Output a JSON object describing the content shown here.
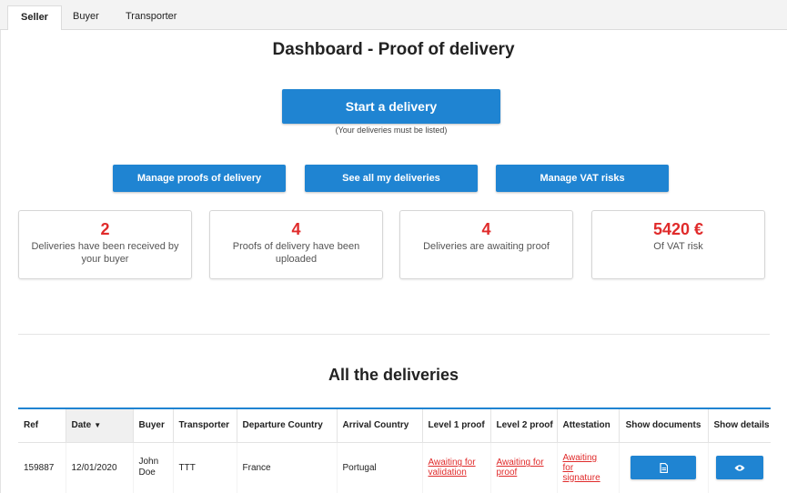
{
  "tabs": [
    "Seller",
    "Buyer",
    "Transporter"
  ],
  "title": "Dashboard - Proof of delivery",
  "start_button": "Start a delivery",
  "start_note": "(Your deliveries must be listed)",
  "actions": [
    "Manage proofs of delivery",
    "See all my deliveries",
    "Manage VAT risks"
  ],
  "stats": [
    {
      "value": "2",
      "label": "Deliveries have been received by your buyer"
    },
    {
      "value": "4",
      "label": "Proofs of delivery have been uploaded"
    },
    {
      "value": "4",
      "label": "Deliveries are awaiting proof"
    },
    {
      "value": "5420 €",
      "label": "Of VAT risk"
    }
  ],
  "section_title": "All the deliveries",
  "table": {
    "headers": [
      "Ref",
      "Date",
      "Buyer",
      "Transporter",
      "Departure Country",
      "Arrival Country",
      "Level 1 proof",
      "Level 2 proof",
      "Attestation",
      "Show documents",
      "Show details"
    ],
    "sort_caret": "▼",
    "rows": [
      {
        "ref": "159887",
        "date": "12/01/2020",
        "buyer": "John Doe",
        "transporter": "TTT",
        "departure": "France",
        "arrival": "Portugal",
        "level1": "Awaiting for validation",
        "level2": "Awaiting for proof",
        "attestation": "Awaiting for signature",
        "documents_icon": "document-icon",
        "details_icon": "eye-icon"
      }
    ]
  },
  "colors": {
    "primary": "#1f84d2",
    "alert": "#e02b2b"
  }
}
